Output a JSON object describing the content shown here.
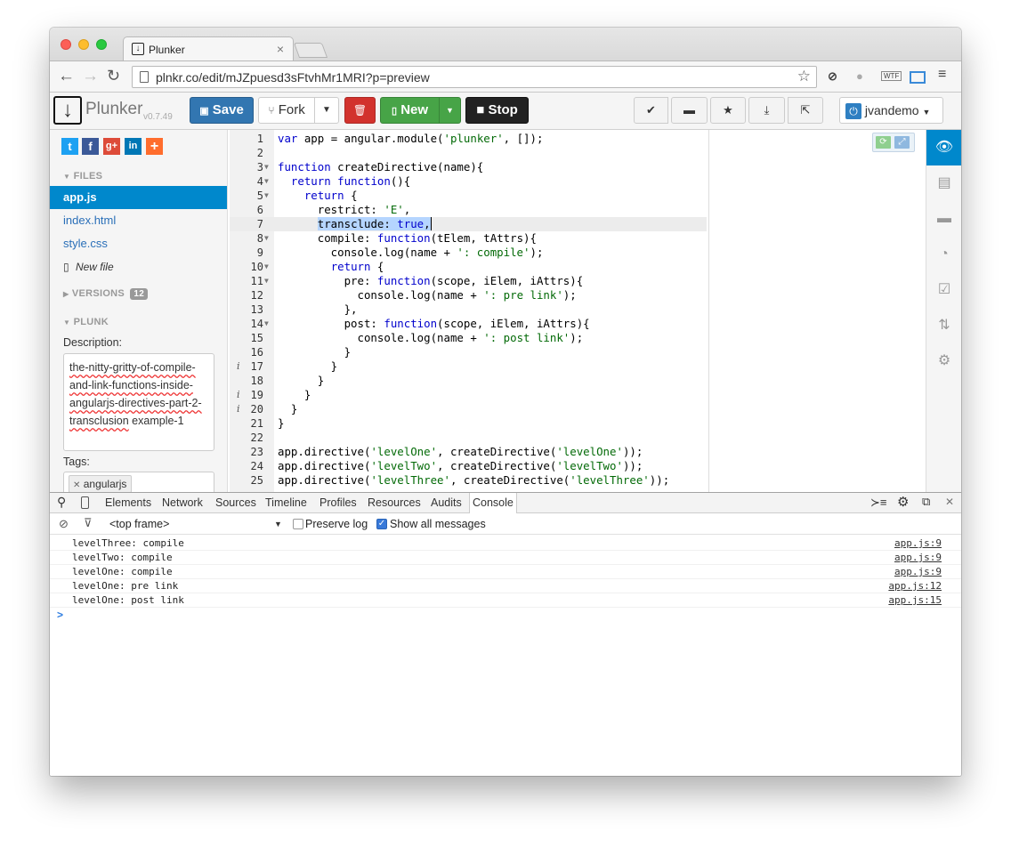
{
  "browser": {
    "tab_title": "Plunker",
    "tab_close": "×",
    "url": "plnkr.co/edit/mJZpuesd3sFtvhMr1MRI?p=preview"
  },
  "toolbar": {
    "logo_text": "Plunker",
    "logo_version": "v0.7.49",
    "save_label": "Save",
    "fork_label": "Fork",
    "new_label": "New",
    "stop_label": "Stop",
    "user_label": "jvandemo"
  },
  "sidebar": {
    "files_heading": "FILES",
    "files": [
      {
        "name": "app.js",
        "active": true
      },
      {
        "name": "index.html",
        "active": false
      },
      {
        "name": "style.css",
        "active": false
      }
    ],
    "new_file_label": "New file",
    "versions_heading": "VERSIONS",
    "versions_count": "12",
    "plunk_heading": "PLUNK",
    "description_label": "Description:",
    "description_lines": [
      "the-nitty-gritty-of-compile-",
      "and-link-functions-inside-",
      "angularjs-directives-part-2-"
    ],
    "description_last_squiggled": "transclusion",
    "description_last_plain": " example-1",
    "tags_label": "Tags:",
    "tag": "angularjs"
  },
  "editor": {
    "lines": [
      {
        "n": "1",
        "code": "var app = angular.module('plunker', []);"
      },
      {
        "n": "2",
        "code": ""
      },
      {
        "n": "3",
        "code": "function createDirective(name){"
      },
      {
        "n": "4",
        "code": "  return function(){"
      },
      {
        "n": "5",
        "code": "    return {"
      },
      {
        "n": "6",
        "code": "      restrict: 'E',"
      },
      {
        "n": "7",
        "code": "      transclude: true,"
      },
      {
        "n": "8",
        "code": "      compile: function(tElem, tAttrs){"
      },
      {
        "n": "9",
        "code": "        console.log(name + ': compile');"
      },
      {
        "n": "10",
        "code": "        return {"
      },
      {
        "n": "11",
        "code": "          pre: function(scope, iElem, iAttrs){"
      },
      {
        "n": "12",
        "code": "            console.log(name + ': pre link');"
      },
      {
        "n": "13",
        "code": "          },"
      },
      {
        "n": "14",
        "code": "          post: function(scope, iElem, iAttrs){"
      },
      {
        "n": "15",
        "code": "            console.log(name + ': post link');"
      },
      {
        "n": "16",
        "code": "          }"
      },
      {
        "n": "17",
        "code": "        }"
      },
      {
        "n": "18",
        "code": "      }"
      },
      {
        "n": "19",
        "code": "    }"
      },
      {
        "n": "20",
        "code": "  }"
      },
      {
        "n": "21",
        "code": "}"
      },
      {
        "n": "22",
        "code": ""
      },
      {
        "n": "23",
        "code": "app.directive('levelOne', createDirective('levelOne'));"
      },
      {
        "n": "24",
        "code": "app.directive('levelTwo', createDirective('levelTwo'));"
      },
      {
        "n": "25",
        "code": "app.directive('levelThree', createDirective('levelThree'));"
      }
    ]
  },
  "devtools": {
    "tabs": [
      "Elements",
      "Network",
      "Sources",
      "Timeline",
      "Profiles",
      "Resources",
      "Audits",
      "Console"
    ],
    "active_tab": "Console",
    "frame_label": "<top frame>",
    "preserve_log_label": "Preserve log",
    "show_all_label": "Show all messages",
    "messages": [
      {
        "text": "levelThree: compile",
        "source": "app.js:9"
      },
      {
        "text": "levelTwo: compile",
        "source": "app.js:9"
      },
      {
        "text": "levelOne: compile",
        "source": "app.js:9"
      },
      {
        "text": "levelOne: pre link",
        "source": "app.js:12"
      },
      {
        "text": "levelOne: post link",
        "source": "app.js:15"
      }
    ],
    "prompt": ">"
  }
}
